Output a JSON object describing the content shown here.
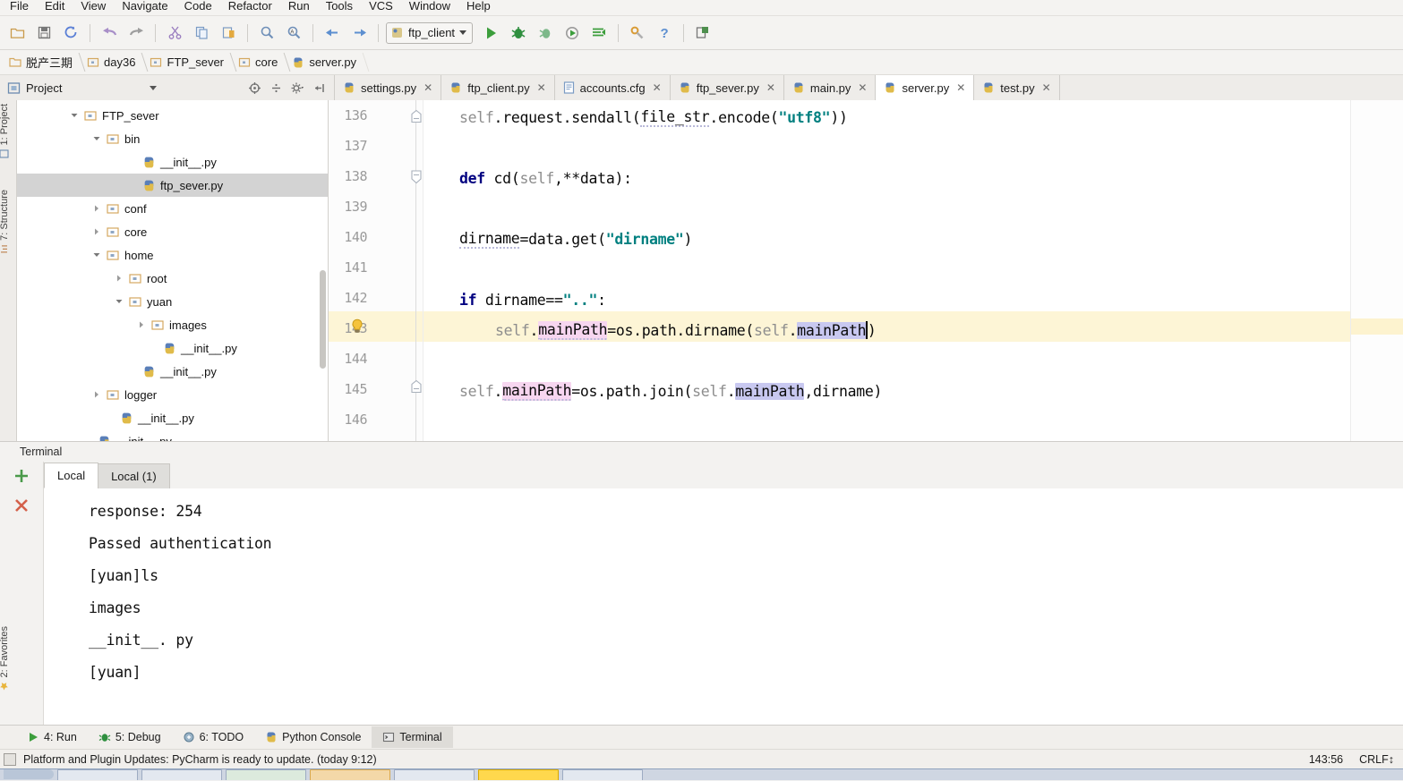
{
  "menu": {
    "items": [
      "File",
      "Edit",
      "View",
      "Navigate",
      "Code",
      "Refactor",
      "Run",
      "Tools",
      "VCS",
      "Window",
      "Help"
    ]
  },
  "toolbar": {
    "icons": [
      "open-folder-icon",
      "save-all-icon",
      "sync-icon",
      "undo-icon",
      "redo-icon",
      "cut-icon",
      "copy-icon",
      "paste-icon",
      "find-icon",
      "replace-icon",
      "back-icon",
      "forward-icon"
    ],
    "run_config": "ftp_client",
    "run_icons": [
      "run-icon",
      "debug-icon",
      "coverage-icon",
      "profile-icon",
      "run-with-console-icon",
      "settings-wrench-icon",
      "help-icon",
      "update-icon"
    ]
  },
  "breadcrumb": {
    "items": [
      {
        "label": "脱产三期",
        "icon": "folder-icon"
      },
      {
        "label": "day36",
        "icon": "folder-icon"
      },
      {
        "label": "FTP_sever",
        "icon": "folder-icon"
      },
      {
        "label": "core",
        "icon": "folder-icon"
      },
      {
        "label": "server.py",
        "icon": "python-file-icon"
      }
    ]
  },
  "project_panel": {
    "title": "Project",
    "tools": [
      "locate-icon",
      "collapse-all-icon",
      "settings-gear-icon",
      "hide-icon"
    ],
    "tree": [
      {
        "label": "FTP_sever",
        "depth": 2,
        "arrow": "down",
        "icon": "folder-icon",
        "selected": false
      },
      {
        "label": "bin",
        "depth": 3,
        "arrow": "down",
        "icon": "folder-icon",
        "selected": false
      },
      {
        "label": "__init__.py",
        "depth": 4,
        "arrow": "none",
        "icon": "python-file-icon",
        "selected": false
      },
      {
        "label": "ftp_sever.py",
        "depth": 4,
        "arrow": "none",
        "icon": "python-file-icon",
        "selected": true
      },
      {
        "label": "conf",
        "depth": 3,
        "arrow": "right",
        "icon": "folder-icon",
        "selected": false
      },
      {
        "label": "core",
        "depth": 3,
        "arrow": "right",
        "icon": "folder-icon",
        "selected": false
      },
      {
        "label": "home",
        "depth": 3,
        "arrow": "down",
        "icon": "folder-icon",
        "selected": false
      },
      {
        "label": "root",
        "depth": 4,
        "arrow": "right",
        "icon": "folder-icon",
        "selected": false
      },
      {
        "label": "yuan",
        "depth": 4,
        "arrow": "down",
        "icon": "folder-icon",
        "selected": false
      },
      {
        "label": "images",
        "depth": 5,
        "arrow": "right",
        "icon": "folder-icon",
        "selected": false
      },
      {
        "label": "__init__.py",
        "depth": 5,
        "arrow": "none",
        "icon": "python-file-icon",
        "selected": false
      },
      {
        "label": "__init__.py",
        "depth": 4,
        "arrow": "none",
        "icon": "python-file-icon",
        "selected": false
      },
      {
        "label": "logger",
        "depth": 3,
        "arrow": "right",
        "icon": "folder-icon",
        "selected": false
      },
      {
        "label": "__init__.py",
        "depth": 3,
        "arrow": "none",
        "icon": "python-file-icon",
        "selected": false
      },
      {
        "label": "__init__.py",
        "depth": 2,
        "arrow": "none",
        "icon": "python-file-icon",
        "selected": false
      }
    ]
  },
  "left_rail": [
    {
      "label": "1: Project",
      "icon": "project-icon"
    },
    {
      "label": "7: Structure",
      "icon": "structure-icon"
    },
    {
      "label": "2: Favorites",
      "icon": "star-icon"
    }
  ],
  "editor_tabs": [
    {
      "label": "settings.py",
      "icon": "python-file-icon",
      "active": false
    },
    {
      "label": "ftp_client.py",
      "icon": "python-file-icon",
      "active": false
    },
    {
      "label": "accounts.cfg",
      "icon": "config-file-icon",
      "active": false
    },
    {
      "label": "ftp_sever.py",
      "icon": "python-file-icon",
      "active": false
    },
    {
      "label": "main.py",
      "icon": "python-file-icon",
      "active": false
    },
    {
      "label": "server.py",
      "icon": "python-file-icon",
      "active": true
    },
    {
      "label": "test.py",
      "icon": "python-file-icon",
      "active": false
    }
  ],
  "editor": {
    "line_numbers": [
      "136",
      "137",
      "138",
      "139",
      "140",
      "141",
      "142",
      "143",
      "144",
      "145",
      "146"
    ],
    "lines": [
      "        self.request.sendall(file_str.encode(\"utf8\"))",
      "",
      "    def cd(self,**data):",
      "",
      "        dirname=data.get(\"dirname\")",
      "",
      "        if dirname==\"..\":",
      "            self.mainPath=os.path.dirname(self.mainPath)",
      "",
      "        self.mainPath=os.path.join(self.mainPath,dirname)",
      ""
    ],
    "highlighted_line": "143",
    "gutter_icons": [
      {
        "line": "136",
        "icon": "fold-end-icon"
      },
      {
        "line": "138",
        "icon": "fold-start-icon"
      },
      {
        "line": "143",
        "icon": "intention-bulb-icon"
      },
      {
        "line": "145",
        "icon": "fold-end-icon"
      }
    ],
    "colors": {
      "keyword": "#000080",
      "string": "#008080",
      "self_param": "#8d8d8d",
      "write_usage_highlight": "#f7d6f0",
      "read_usage_highlight": "#c8c8f0",
      "caret_row": "#fdf5d6"
    }
  },
  "terminal": {
    "window_title": "Terminal",
    "rail_icons": [
      "add-tab-icon",
      "close-tab-icon"
    ],
    "tabs": [
      {
        "label": "Local",
        "active": true
      },
      {
        "label": "Local (1)",
        "active": false
      }
    ],
    "output": [
      "response: 254",
      "Passed authentication",
      "[yuan]ls",
      "images",
      "__init__. py",
      "[yuan]"
    ]
  },
  "bottom_bar": [
    {
      "label": "4: Run",
      "icon": "run-icon",
      "active": false
    },
    {
      "label": "5: Debug",
      "icon": "debug-icon",
      "active": false
    },
    {
      "label": "6: TODO",
      "icon": "todo-icon",
      "active": false
    },
    {
      "label": "Python Console",
      "icon": "python-console-icon",
      "active": false
    },
    {
      "label": "Terminal",
      "icon": "terminal-icon",
      "active": true
    }
  ],
  "status_bar": {
    "message": "Platform and Plugin Updates: PyCharm is ready to update. (today 9:12)",
    "caret_position": "143:56",
    "line_separator": "CRLF"
  }
}
